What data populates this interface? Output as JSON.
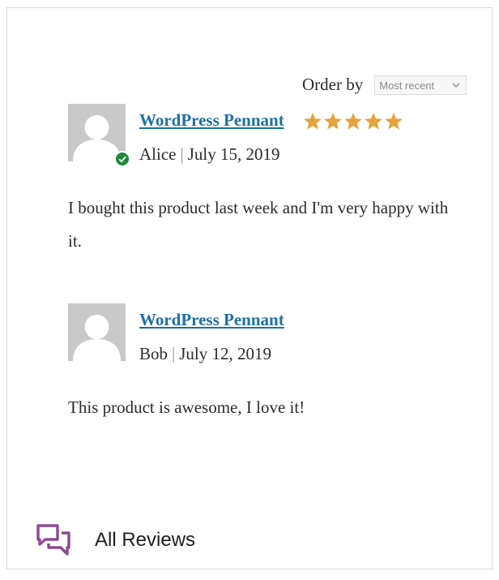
{
  "order_by": {
    "label": "Order by",
    "selected": "Most recent"
  },
  "reviews": [
    {
      "product": "WordPress Pennant",
      "rating": 5,
      "author": "Alice",
      "date": "July 15, 2019",
      "verified": true,
      "text": "I bought this product last week and I'm very happy with it."
    },
    {
      "product": "WordPress Pennant",
      "author": "Bob",
      "date": "July 12, 2019",
      "verified": false,
      "text": "This product is awesome, I love it!"
    }
  ],
  "footer": {
    "title": "All Reviews",
    "icon": "comments-icon"
  },
  "colors": {
    "link": "#1d6fa5",
    "star": "#e6a23c",
    "verified": "#1f8a3b",
    "footer_icon": "#8c4b8f"
  },
  "separator": "|"
}
